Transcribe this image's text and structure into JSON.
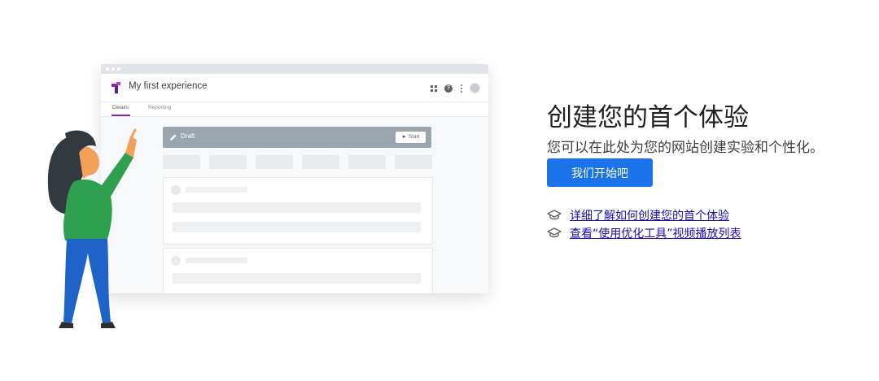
{
  "illustration": {
    "window_title": "My first experience",
    "tabs": [
      "Details",
      "Reporting"
    ],
    "status_label": "Draft",
    "start_label": "► Start",
    "help_glyph": "?"
  },
  "headline": "创建您的首个体验",
  "subheadline": "您可以在此处为您的网站创建实验和个性化。",
  "cta_label": "我们开始吧",
  "links": [
    {
      "icon": "graduation-cap-icon",
      "label": "详细了解如何创建您的首个体验"
    },
    {
      "icon": "graduation-cap-icon",
      "label": "查看“使用优化工具”视频播放列表"
    }
  ],
  "colors": {
    "accent": "#1a73e8",
    "link": "#1a0dab",
    "tab_underline": "#8e24aa",
    "logo": "#8e24aa"
  }
}
